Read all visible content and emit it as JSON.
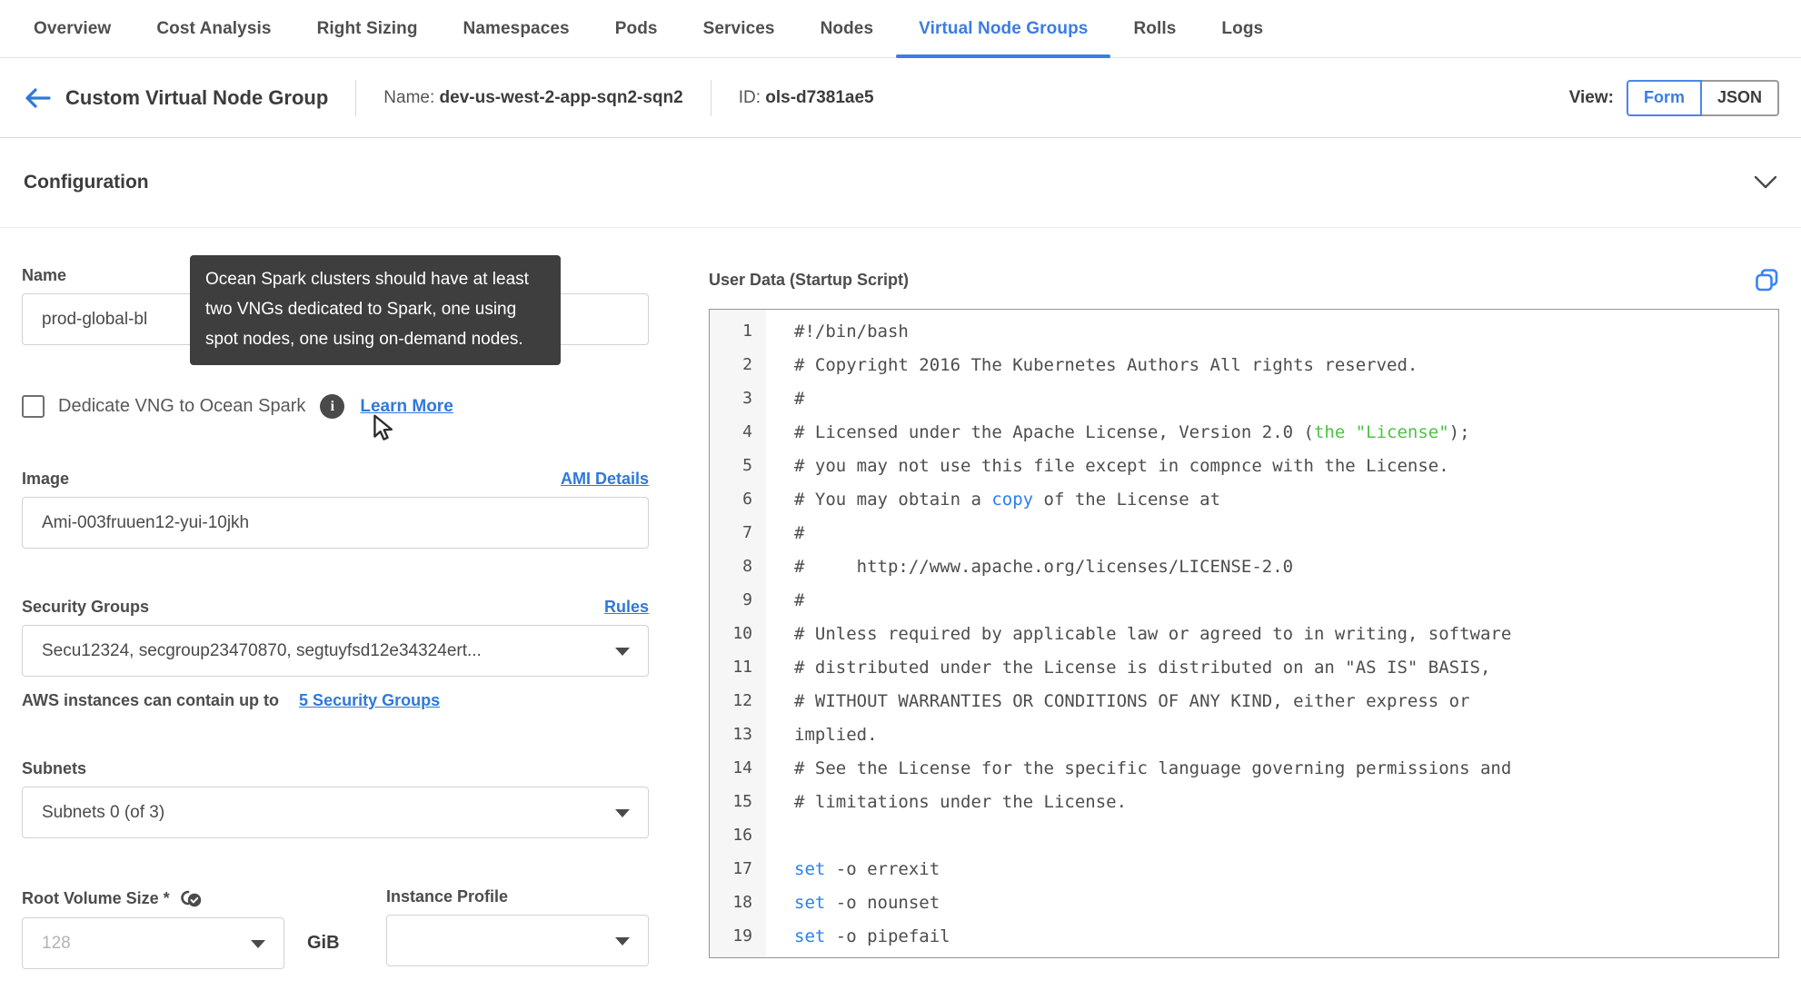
{
  "tabs": {
    "items": [
      "Overview",
      "Cost Analysis",
      "Right Sizing",
      "Namespaces",
      "Pods",
      "Services",
      "Nodes",
      "Virtual Node Groups",
      "Rolls",
      "Logs"
    ],
    "active": "Virtual Node Groups"
  },
  "header": {
    "title": "Custom Virtual Node Group",
    "name_label": "Name:",
    "name_value": "dev-us-west-2-app-sqn2-sqn2",
    "id_label": "ID:",
    "id_value": "ols-d7381ae5",
    "view_label": "View:",
    "view_options": [
      "Form",
      "JSON"
    ],
    "view_active": "Form"
  },
  "section": {
    "title": "Configuration"
  },
  "form": {
    "name": {
      "label": "Name",
      "value": "prod-global-bl"
    },
    "tooltip": {
      "text": "Ocean Spark clusters should have at least two VNGs dedicated to Spark, one using spot nodes, one using on-demand nodes."
    },
    "dedicate": {
      "label": "Dedicate VNG to Ocean Spark",
      "checked": false,
      "learn_more": "Learn More"
    },
    "image": {
      "label": "Image",
      "link": "AMI Details",
      "value": "Ami-003fruuen12-yui-10jkh"
    },
    "security_groups": {
      "label": "Security Groups",
      "link": "Rules",
      "value": "Secu12324, secgroup23470870, segtuyfsd12e34324ert...",
      "hint_text": "AWS instances can contain up to",
      "hint_link": "5 Security Groups"
    },
    "subnets": {
      "label": "Subnets",
      "value": "Subnets 0 (of 3)"
    },
    "root_volume": {
      "label": "Root Volume Size *",
      "placeholder": "128",
      "unit": "GiB"
    },
    "instance_profile": {
      "label": "Instance Profile",
      "value": ""
    }
  },
  "editor": {
    "label": "User Data (Startup Script)",
    "lines": [
      [
        {
          "text": "#!/bin/bash",
          "color": "default"
        }
      ],
      [
        {
          "text": "# Copyright 2016 The Kubernetes Authors All rights reserved.",
          "color": "default"
        }
      ],
      [
        {
          "text": "#",
          "color": "default"
        }
      ],
      [
        {
          "text": "# Licensed under the Apache License, Version 2.0 (",
          "color": "default"
        },
        {
          "text": "the \"License\"",
          "color": "green"
        },
        {
          "text": ");",
          "color": "default"
        }
      ],
      [
        {
          "text": "# you may not use this file except in compnce with the License.",
          "color": "default"
        }
      ],
      [
        {
          "text": "# You may obtain a ",
          "color": "default"
        },
        {
          "text": "copy",
          "color": "blue"
        },
        {
          "text": " of the License at",
          "color": "default"
        }
      ],
      [
        {
          "text": "#",
          "color": "default"
        }
      ],
      [
        {
          "text": "#     http://www.apache.org/licenses/LICENSE-2.0",
          "color": "default"
        }
      ],
      [
        {
          "text": "#",
          "color": "default"
        }
      ],
      [
        {
          "text": "# Unless required by applicable law or agreed to in writing, software",
          "color": "default"
        }
      ],
      [
        {
          "text": "# distributed under the License is distributed on an \"AS IS\" BASIS,",
          "color": "default"
        }
      ],
      [
        {
          "text": "# WITHOUT WARRANTIES OR CONDITIONS OF ANY KIND, either express or",
          "color": "default"
        }
      ],
      [
        {
          "text": "implied.",
          "color": "default"
        }
      ],
      [
        {
          "text": "# See the License for the specific language governing permissions and",
          "color": "default"
        }
      ],
      [
        {
          "text": "# limitations under the License.",
          "color": "default"
        }
      ],
      [],
      [
        {
          "text": "set",
          "color": "blue"
        },
        {
          "text": " -o errexit",
          "color": "default"
        }
      ],
      [
        {
          "text": "set",
          "color": "blue"
        },
        {
          "text": " -o nounset",
          "color": "default"
        }
      ],
      [
        {
          "text": "set",
          "color": "blue"
        },
        {
          "text": " -o pipefail",
          "color": "default"
        }
      ]
    ]
  },
  "colors": {
    "accent_blue": "#3b7de2",
    "link_blue": "#2f79d9",
    "code_green": "#4fc247",
    "code_blue": "#2d7ff0",
    "tooltip_bg": "#3e3e3e"
  }
}
